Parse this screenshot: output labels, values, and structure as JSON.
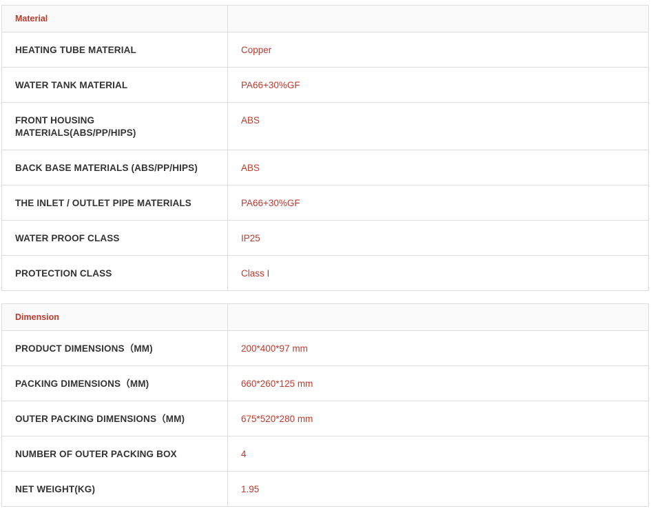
{
  "sections": {
    "material": {
      "title": "Material",
      "rows": [
        {
          "label": "HEATING TUBE MATERIAL",
          "value": "Copper"
        },
        {
          "label": "WATER TANK MATERIAL",
          "value": "PA66+30%GF"
        },
        {
          "label": "FRONT HOUSING MATERIALS(ABS/PP/HIPS)",
          "value": "ABS"
        },
        {
          "label": "BACK BASE MATERIALS (ABS/PP/HIPS)",
          "value": "ABS"
        },
        {
          "label": "THE INLET / OUTLET PIPE MATERIALS",
          "value": "PA66+30%GF"
        },
        {
          "label": "WATER PROOF CLASS",
          "value": "IP25"
        },
        {
          "label": "PROTECTION CLASS",
          "value": "Class I"
        }
      ]
    },
    "dimension": {
      "title": "Dimension",
      "rows": [
        {
          "label": "PRODUCT DIMENSIONS（MM)",
          "value": "200*400*97 mm"
        },
        {
          "label": "PACKING DIMENSIONS（MM)",
          "value": "660*260*125 mm"
        },
        {
          "label": "OUTER PACKING DIMENSIONS（MM)",
          "value": "675*520*280 mm"
        },
        {
          "label": "NUMBER OF OUTER PACKING BOX",
          "value": "4"
        },
        {
          "label": "NET WEIGHT(KG)",
          "value": "1.95"
        }
      ]
    }
  },
  "colors": {
    "accent": "#c0392b",
    "label_text": "#333333",
    "border": "#dddddd",
    "header_bg": "#fafafa"
  }
}
